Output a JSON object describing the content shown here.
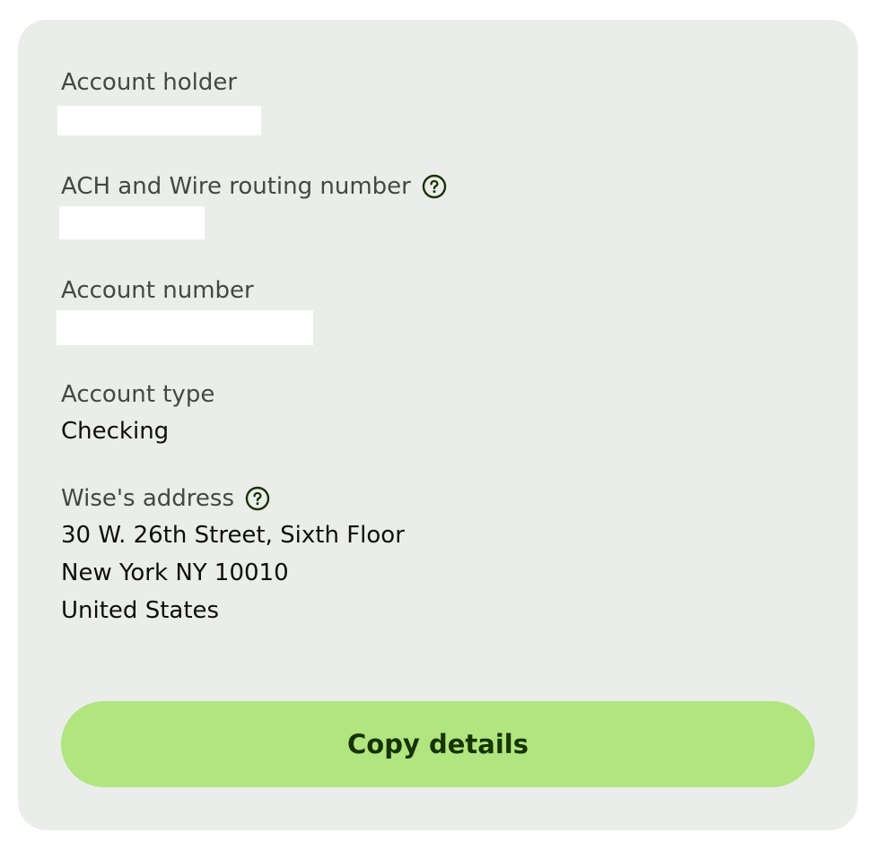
{
  "account_holder": {
    "label": "Account holder"
  },
  "routing": {
    "label": "ACH and Wire routing number",
    "help_icon": "question-circle-icon"
  },
  "account_number": {
    "label": "Account number"
  },
  "account_type": {
    "label": "Account type",
    "value": "Checking"
  },
  "address": {
    "label": "Wise's address",
    "help_icon": "question-circle-icon",
    "lines": [
      "30 W. 26th Street, Sixth Floor",
      "New York NY 10010",
      "United States"
    ]
  },
  "copy_button": {
    "label": "Copy details"
  },
  "colors": {
    "card_background": "#ebedea",
    "button_background": "#b0e57f",
    "button_text": "#163300",
    "label_text": "#454745",
    "value_text": "#0e0f0c"
  }
}
